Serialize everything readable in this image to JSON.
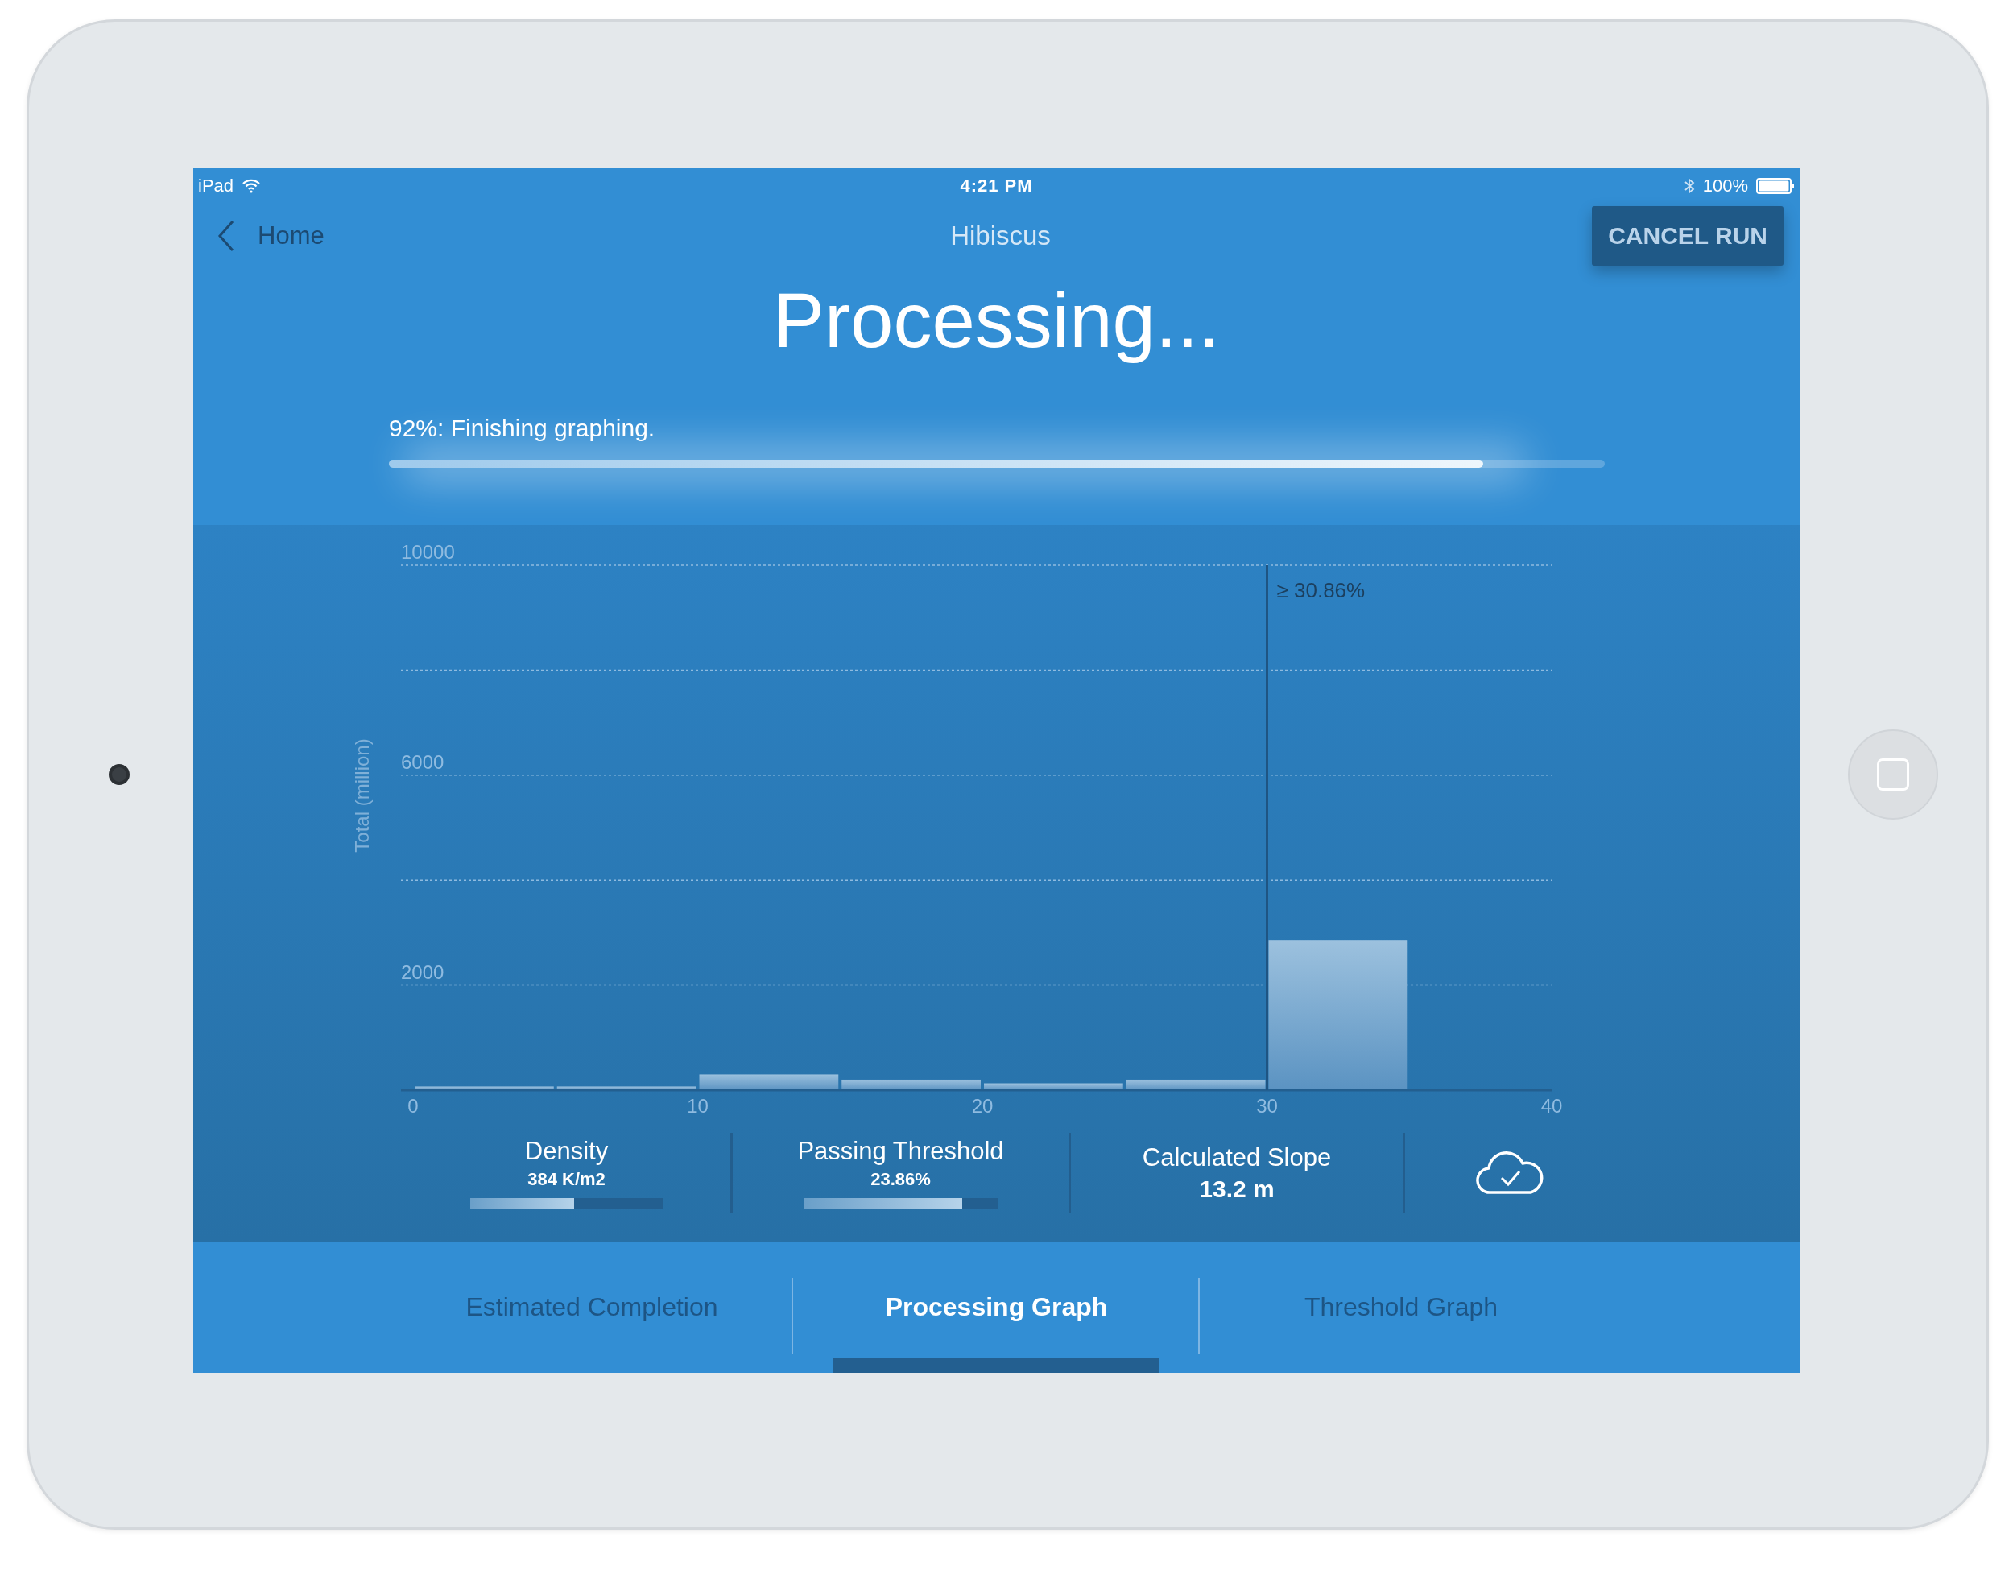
{
  "status_bar": {
    "carrier": "iPad",
    "time": "4:21 PM",
    "battery": "100%"
  },
  "nav": {
    "back": "Home",
    "title": "Hibiscus",
    "action": "CANCEL RUN"
  },
  "heading": "Processing...",
  "progress": {
    "label": "92%: Finishing graphing.",
    "level": 0.9
  },
  "chart": {
    "chart_data": {
      "type": "bar",
      "ylabel": "Total (million)",
      "x": [
        2.5,
        7.5,
        12.5,
        17.5,
        22.5,
        27.5,
        32.5
      ],
      "values": [
        70,
        70,
        300,
        200,
        130,
        200,
        2850
      ],
      "xlim": [
        0,
        40
      ],
      "ylim": [
        0,
        10000
      ],
      "xticks": [
        0,
        10,
        20,
        30,
        40
      ],
      "yticks": [
        2000,
        6000,
        10000
      ],
      "ref_lines": [
        {
          "axis": "x",
          "value": 30
        }
      ],
      "annotations": [
        "≥ 30.86%"
      ]
    }
  },
  "stats": [
    {
      "kind": "gauge",
      "label": "Density",
      "value": "384 K/m2",
      "level": 0.54
    },
    {
      "kind": "gauge",
      "label": "Passing Threshold",
      "value": "23.86%",
      "level": 0.82
    },
    {
      "kind": "value",
      "label": "Calculated Slope",
      "value": "13.2 m"
    },
    {
      "kind": "cloud"
    }
  ],
  "tabs": [
    {
      "label": "Estimated Completion",
      "selected": false
    },
    {
      "label": "Processing Graph",
      "selected": true
    },
    {
      "label": "Threshold Graph",
      "selected": false
    }
  ]
}
